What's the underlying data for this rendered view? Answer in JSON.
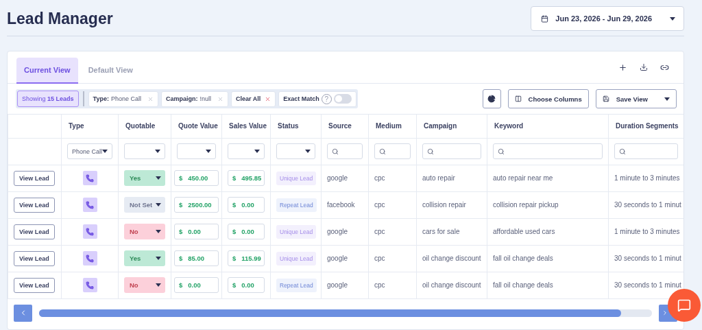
{
  "title": "Lead Manager",
  "date_range": "Jun 23, 2026 - Jun 29, 2026",
  "tabs": [
    {
      "label": "Current View",
      "selected": true
    },
    {
      "label": "Default View",
      "selected": false
    }
  ],
  "filter_bar": {
    "count": "Showing **15 Leads**",
    "chips": [
      {
        "key": "Type:",
        "value": "Phone Call"
      },
      {
        "key": "Campaign:",
        "value": "!null"
      }
    ],
    "clear_all": "Clear All",
    "exact_match": {
      "label": "Exact Match",
      "help": "?",
      "on": false
    },
    "choose_columns": "Choose Columns",
    "save_view": "Save View"
  },
  "columns": [
    "",
    "Type",
    "Quotable",
    "Quote Value",
    "Sales Value",
    "Status",
    "Source",
    "Medium",
    "Campaign",
    "Keyword",
    "Duration Segments"
  ],
  "column_filters": [
    {
      "kind": "none"
    },
    {
      "kind": "select",
      "value": "Phone Call"
    },
    {
      "kind": "select"
    },
    {
      "kind": "select"
    },
    {
      "kind": "select"
    },
    {
      "kind": "select"
    },
    {
      "kind": "search"
    },
    {
      "kind": "search"
    },
    {
      "kind": "search"
    },
    {
      "kind": "search"
    },
    {
      "kind": "search"
    }
  ],
  "rows": [
    {
      "action": "View Lead",
      "quotable": {
        "label": "Yes",
        "kind": "yes"
      },
      "quote_value": {
        "currency": "$",
        "amount": "450.00"
      },
      "sales_value": {
        "currency": "$",
        "amount": "495.85"
      },
      "status": {
        "label": "Unique Lead",
        "kind": "unique"
      },
      "source": "google",
      "medium": "cpc",
      "campaign": "auto repair",
      "keyword": "auto repair near me",
      "duration": "1 minute to 3 minutes"
    },
    {
      "action": "View Lead",
      "quotable": {
        "label": "Not Set",
        "kind": "notset"
      },
      "quote_value": {
        "currency": "$",
        "amount": "2500.00"
      },
      "sales_value": {
        "currency": "$",
        "amount": "0.00"
      },
      "status": {
        "label": "Repeat Lead",
        "kind": "repeat"
      },
      "source": "facebook",
      "medium": "cpc",
      "campaign": "collision repair",
      "keyword": "collision repair pickup",
      "duration": "30 seconds to 1 minut"
    },
    {
      "action": "View Lead",
      "quotable": {
        "label": "No",
        "kind": "no"
      },
      "quote_value": {
        "currency": "$",
        "amount": "0.00"
      },
      "sales_value": {
        "currency": "$",
        "amount": "0.00"
      },
      "status": {
        "label": "Unique Lead",
        "kind": "unique"
      },
      "source": "google",
      "medium": "cpc",
      "campaign": "cars for sale",
      "keyword": "affordable used cars",
      "duration": "1 minute to 3 minutes"
    },
    {
      "action": "View Lead",
      "quotable": {
        "label": "Yes",
        "kind": "yes"
      },
      "quote_value": {
        "currency": "$",
        "amount": "85.00"
      },
      "sales_value": {
        "currency": "$",
        "amount": "115.99"
      },
      "status": {
        "label": "Unique Lead",
        "kind": "unique"
      },
      "source": "google",
      "medium": "cpc",
      "campaign": "oil change discount",
      "keyword": "fall oil change deals",
      "duration": "30 seconds to 1 minut"
    },
    {
      "action": "View Lead",
      "quotable": {
        "label": "No",
        "kind": "no"
      },
      "quote_value": {
        "currency": "$",
        "amount": "0.00"
      },
      "sales_value": {
        "currency": "$",
        "amount": "0.00"
      },
      "status": {
        "label": "Repeat Lead",
        "kind": "repeat"
      },
      "source": "google",
      "medium": "cpc",
      "campaign": "oil change discount",
      "keyword": "fall oil change deals",
      "duration": "30 seconds to 1 minut"
    }
  ]
}
